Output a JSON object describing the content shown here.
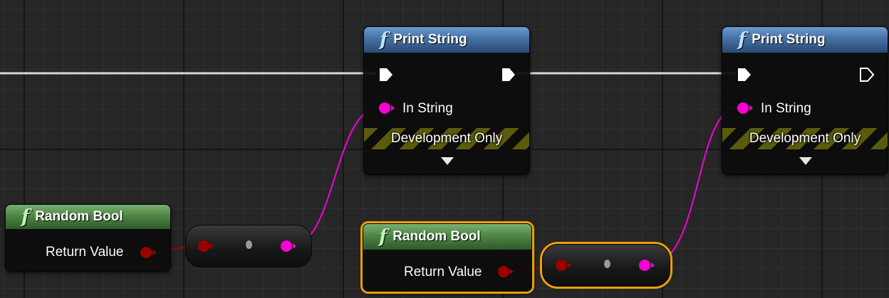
{
  "nodes": {
    "print_string_1": {
      "title": "Print String",
      "in_string_label": "In String",
      "dev_only_label": "Development Only"
    },
    "print_string_2": {
      "title": "Print String",
      "in_string_label": "In String",
      "dev_only_label": "Development Only"
    },
    "random_bool_1": {
      "title": "Random Bool",
      "return_label": "Return Value",
      "selected": false
    },
    "random_bool_2": {
      "title": "Random Bool",
      "return_label": "Return Value",
      "selected": true
    }
  },
  "function_glyph": "f",
  "colors": {
    "canvas_bg": "#262626",
    "exec_wire": "#d8d8d8",
    "string_pin": "#f700d6",
    "bool_pin": "#9a0000",
    "function_header": "#4470a4",
    "pure_function_header": "#4f8646",
    "selection_outline": "#f0a000",
    "dev_only_stripe": "#5b5b0c"
  }
}
